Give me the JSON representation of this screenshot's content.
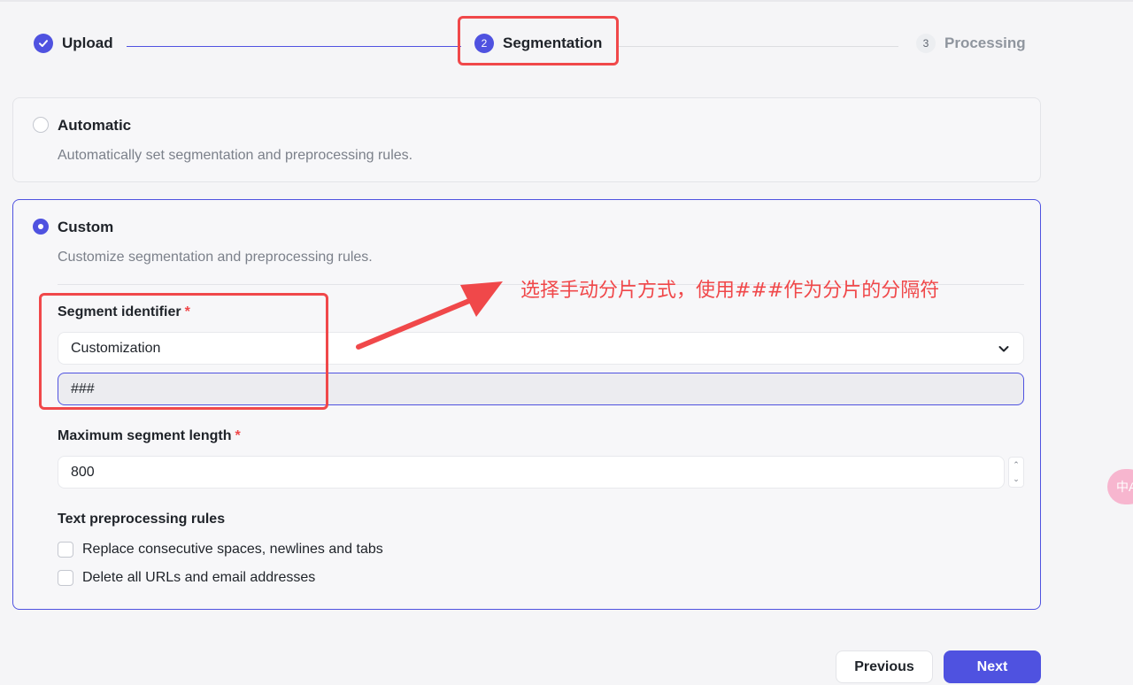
{
  "stepper": {
    "steps": [
      {
        "label": "Upload",
        "state": "done"
      },
      {
        "number": "2",
        "label": "Segmentation",
        "state": "active"
      },
      {
        "number": "3",
        "label": "Processing",
        "state": "pending"
      }
    ]
  },
  "modes": {
    "automatic": {
      "title": "Automatic",
      "description": "Automatically set segmentation and preprocessing rules.",
      "selected": false
    },
    "custom": {
      "title": "Custom",
      "description": "Customize segmentation and preprocessing rules.",
      "selected": true
    }
  },
  "custom_form": {
    "segment_identifier": {
      "label": "Segment identifier",
      "required_mark": "*",
      "selected": "Customization",
      "custom_value": "###"
    },
    "max_length": {
      "label": "Maximum segment length",
      "required_mark": "*",
      "value": "800"
    },
    "preprocessing": {
      "label": "Text preprocessing rules",
      "rules": [
        {
          "label": "Replace consecutive spaces, newlines and tabs",
          "checked": false
        },
        {
          "label": "Delete all URLs and email addresses",
          "checked": false
        }
      ]
    }
  },
  "annotation": {
    "text": "选择手动分片方式，使用###作为分片的分隔符"
  },
  "footer": {
    "previous_label": "Previous",
    "next_label": "Next"
  },
  "floating_widget": {
    "text": "中A"
  },
  "colors": {
    "accent": "#4f52e0",
    "annotation": "#f0484a"
  }
}
